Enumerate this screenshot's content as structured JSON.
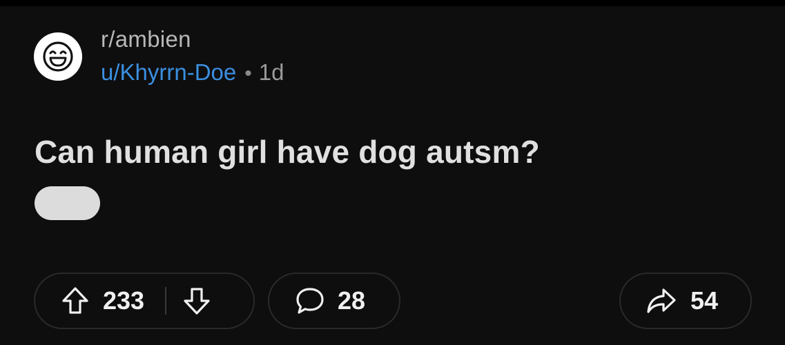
{
  "post": {
    "subreddit": "r/ambien",
    "username": "u/Khyrrn-Doe",
    "separator": "•",
    "age": "1d",
    "title": "Can human girl have dog autsm?",
    "avatar_icon": "smiley-face-icon",
    "flair_color": "#dcdcdc"
  },
  "actions": {
    "upvote_icon": "arrow-up-icon",
    "vote_count": "233",
    "downvote_icon": "arrow-down-icon",
    "comment_icon": "speech-bubble-icon",
    "comment_count": "28",
    "share_icon": "share-arrow-icon",
    "share_count": "54"
  },
  "colors": {
    "background": "#0e0e0e",
    "username": "#3b8fe0",
    "title": "#e0e0e0",
    "pill_border": "#2a2a2a"
  }
}
